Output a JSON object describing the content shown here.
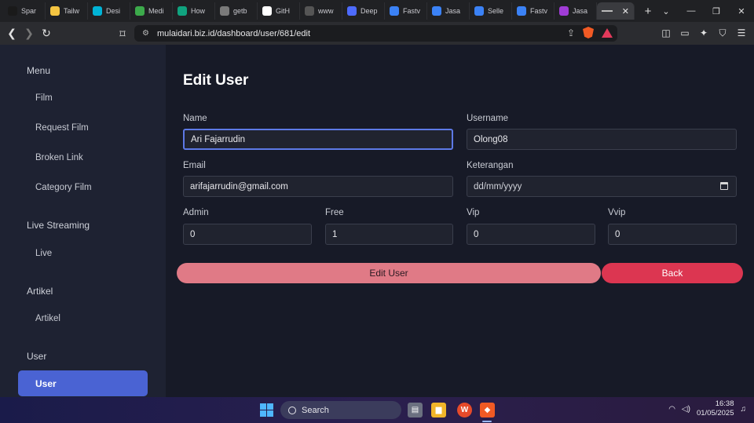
{
  "browser": {
    "tabs": [
      {
        "label": "Spar",
        "icon": "mask-icon",
        "color": "#1a1a1a"
      },
      {
        "label": "Tailw",
        "icon": "emoji-icon",
        "color": "#f5c542"
      },
      {
        "label": "Desi",
        "icon": "canva-icon",
        "color": "#00b3d6"
      },
      {
        "label": "Medi",
        "icon": "leaf-icon",
        "color": "#3caa4b"
      },
      {
        "label": "How",
        "icon": "chat-icon",
        "color": "#10a37f"
      },
      {
        "label": "getb",
        "icon": "bootstrap-icon",
        "color": "#7a7a7a"
      },
      {
        "label": "GitH",
        "icon": "github-icon",
        "color": "#ffffff"
      },
      {
        "label": "www",
        "icon": "dot-icon",
        "color": "#555555"
      },
      {
        "label": "Deep",
        "icon": "deepseek-icon",
        "color": "#4d6bfe"
      },
      {
        "label": "Fastv",
        "icon": "lambda-icon",
        "color": "#3b82f6"
      },
      {
        "label": "Jasa",
        "icon": "lambda-icon",
        "color": "#3b82f6"
      },
      {
        "label": "Selle",
        "icon": "lambda-icon",
        "color": "#3b82f6"
      },
      {
        "label": "Fastv",
        "icon": "lambda-icon",
        "color": "#3b82f6"
      },
      {
        "label": "Jasa",
        "icon": "m-logo-icon",
        "color": "#a03cd6"
      }
    ],
    "url": "mulaidari.biz.id/dashboard/user/681/edit"
  },
  "sidebar": {
    "sections": [
      {
        "title": "Menu",
        "items": [
          "Film",
          "Request Film",
          "Broken Link",
          "Category Film"
        ]
      },
      {
        "title": "Live Streaming",
        "items": [
          "Live"
        ]
      },
      {
        "title": "Artikel",
        "items": [
          "Artikel"
        ]
      },
      {
        "title": "User",
        "items": []
      }
    ],
    "active_item": "User"
  },
  "form": {
    "title": "Edit User",
    "name_label": "Name",
    "name_value": "Ari Fajarrudin",
    "username_label": "Username",
    "username_value": "Olong08",
    "email_label": "Email",
    "email_value": "arifajarrudin@gmail.com",
    "keterangan_label": "Keterangan",
    "keterangan_placeholder": "dd/mm/yyyy",
    "admin_label": "Admin",
    "admin_value": "0",
    "free_label": "Free",
    "free_value": "1",
    "vip_label": "Vip",
    "vip_value": "0",
    "vvip_label": "Vvip",
    "vvip_value": "0",
    "submit_label": "Edit User",
    "back_label": "Back"
  },
  "taskbar": {
    "search_label": "Search",
    "time": "16:38",
    "date": "01/05/2025"
  }
}
